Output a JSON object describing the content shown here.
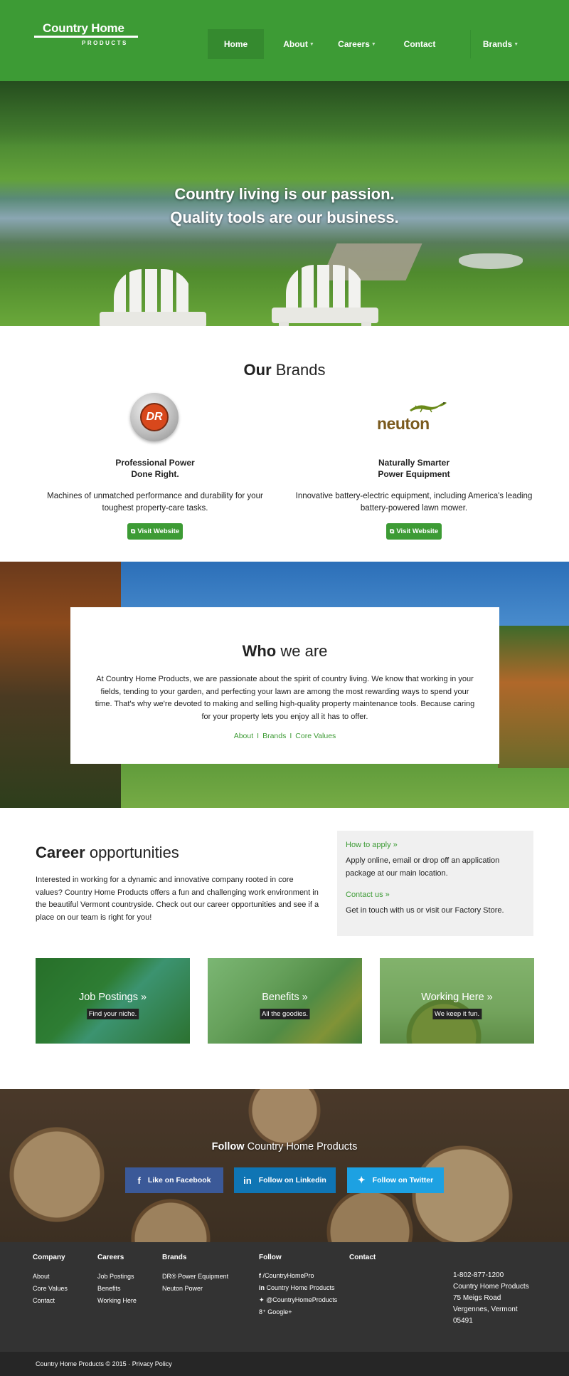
{
  "header": {
    "logo_main": "Country Home",
    "logo_sub": "PRODUCTS",
    "nav": {
      "home": "Home",
      "about": "About",
      "careers": "Careers",
      "contact": "Contact",
      "brands": "Brands"
    }
  },
  "hero": {
    "line1": "Country living is our passion.",
    "line2": "Quality tools are our business."
  },
  "brands": {
    "title_bold": "Our",
    "title_rest": " Brands",
    "dr": {
      "logo_text": "DR",
      "heading_line1": "Professional Power",
      "heading_line2": "Done Right.",
      "description": "Machines of unmatched performance and durability for your toughest property-care tasks.",
      "button": "Visit Website"
    },
    "neuton": {
      "logo_text": "neuton",
      "heading_line1": "Naturally Smarter",
      "heading_line2": "Power Equipment",
      "description": "Innovative battery-electric equipment, including America's leading battery-powered lawn mower.",
      "button": "Visit Website"
    }
  },
  "who": {
    "title_bold": "Who",
    "title_rest": " we are",
    "text": "At Country Home Products, we are passionate about the spirit of country living. We know that working in your fields, tending to your garden, and perfecting your lawn are among the most rewarding ways to spend your time. That's why we're devoted to making and selling high-quality property maintenance tools. Because caring for your property lets you enjoy all it has to offer.",
    "links": [
      "About",
      "Brands",
      "Core Values"
    ],
    "separator": "I"
  },
  "careers": {
    "title_bold": "Career",
    "title_rest": " opportunities",
    "text": "Interested in working for a dynamic and innovative company rooted in core values? Country Home Products offers a fun and challenging work environment in the beautiful Vermont countryside. Check out our career opportunities and see if a place on our team is right for you!",
    "how_to_apply": "How to apply »",
    "apply_text": "Apply online, email or drop off an application package at our main location.",
    "contact_us": "Contact us »",
    "contact_text": "Get in touch with us or visit our Factory Store.",
    "tiles": [
      {
        "title": "Job Postings »",
        "subtitle": "Find your niche."
      },
      {
        "title": "Benefits »",
        "subtitle": "All the goodies."
      },
      {
        "title": "Working Here »",
        "subtitle": "We keep it fun."
      }
    ]
  },
  "follow": {
    "title_bold": "Follow",
    "title_rest": " Country Home Products",
    "facebook": "Like on Facebook",
    "linkedin": "Follow on Linkedin",
    "twitter": "Follow on Twitter",
    "colors": {
      "facebook": "#3b5998",
      "linkedin": "#0f75b4",
      "twitter": "#1da1e2"
    }
  },
  "footer": {
    "company": {
      "heading": "Company",
      "items": [
        "About",
        "Core Values",
        "Contact"
      ]
    },
    "careers": {
      "heading": "Careers",
      "items": [
        "Job Postings",
        "Benefits",
        "Working Here"
      ]
    },
    "brands": {
      "heading": "Brands",
      "items": [
        "DR® Power Equipment",
        "Neuton Power"
      ]
    },
    "follow": {
      "heading": "Follow",
      "items": [
        "/CountryHomePro",
        "Country Home Products",
        "@CountryHomeProducts",
        "Google+"
      ]
    },
    "contact": {
      "heading": "Contact",
      "phone": "1-802-877-1200",
      "name": "Country Home Products",
      "street": "75 Meigs Road",
      "city": "Vergennes, Vermont",
      "zip": "05491"
    },
    "copyright": "Country Home Products © 2015 · Privacy Policy"
  },
  "colors": {
    "brand_green": "#3d9b35",
    "footer_dark": "#333333"
  }
}
